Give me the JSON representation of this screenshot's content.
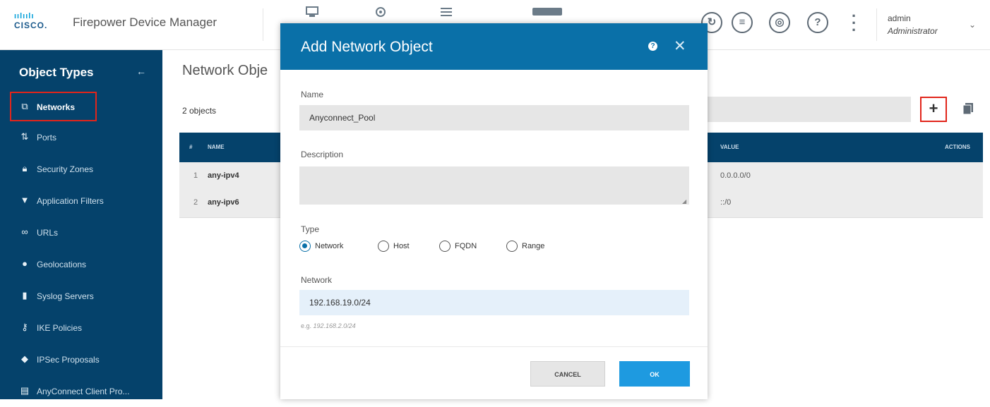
{
  "header": {
    "brand_bars": "ıılıılı",
    "brand_word": "CISCO.",
    "app_title": "Firepower Device Manager",
    "user_name": "admin",
    "user_role": "Administrator",
    "colors": {
      "accent": "#049fd9",
      "nav_bg": "#05426b"
    }
  },
  "sidebar": {
    "title": "Object Types",
    "items": [
      {
        "label": "Networks",
        "icon": "networks-icon",
        "glyph": "⧉"
      },
      {
        "label": "Ports",
        "icon": "ports-icon",
        "glyph": "⇅"
      },
      {
        "label": "Security Zones",
        "icon": "lock-icon",
        "glyph": "🔒︎"
      },
      {
        "label": "Application Filters",
        "icon": "filter-icon",
        "glyph": "▼"
      },
      {
        "label": "URLs",
        "icon": "link-icon",
        "glyph": "∞"
      },
      {
        "label": "Geolocations",
        "icon": "location-pin-icon",
        "glyph": "●"
      },
      {
        "label": "Syslog Servers",
        "icon": "server-icon",
        "glyph": "▮"
      },
      {
        "label": "IKE Policies",
        "icon": "key-icon",
        "glyph": "⚷"
      },
      {
        "label": "IPSec Proposals",
        "icon": "tunnel-icon",
        "glyph": "◆"
      },
      {
        "label": "AnyConnect Client Pro...",
        "icon": "client-profile-icon",
        "glyph": "▤"
      }
    ]
  },
  "main": {
    "page_title": "Network Obje",
    "count_label": "2 objects",
    "table": {
      "col_num": "#",
      "col_name": "NAME",
      "col_value": "VALUE",
      "col_actions": "ACTIONS",
      "rows": [
        {
          "num": "1",
          "name": "any-ipv4",
          "value": "0.0.0.0/0"
        },
        {
          "num": "2",
          "name": "any-ipv6",
          "value": "::/0"
        }
      ]
    }
  },
  "modal": {
    "title": "Add Network Object",
    "name_label": "Name",
    "name_value": "Anyconnect_Pool",
    "description_label": "Description",
    "description_value": "",
    "type_label": "Type",
    "type_options": [
      "Network",
      "Host",
      "FQDN",
      "Range"
    ],
    "type_selected": "Network",
    "network_label": "Network",
    "network_value": "192.168.19.0/24",
    "hint_prefix": "e.g.",
    "hint_example": "192.168.2.0/24",
    "cancel_label": "CANCEL",
    "ok_label": "OK"
  }
}
